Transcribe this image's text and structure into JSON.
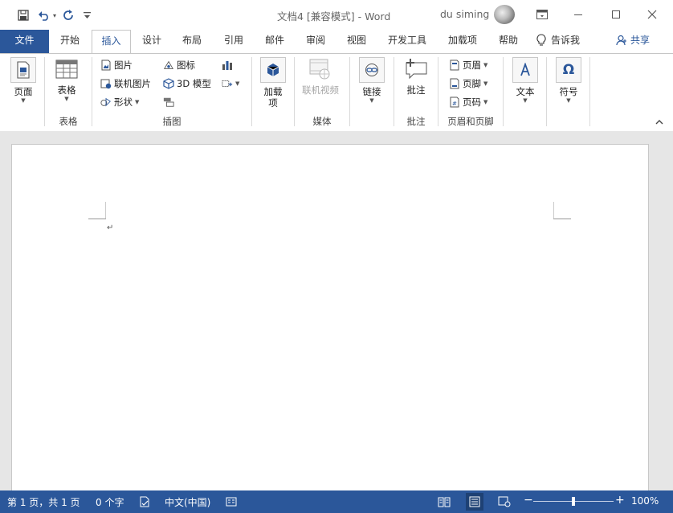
{
  "titlebar": {
    "title": "文档4 [兼容模式]  -  Word",
    "user": "du siming",
    "icons": {
      "save": "save-icon",
      "undo": "undo-icon",
      "redo": "redo-icon",
      "customize": "customize-qat-icon"
    }
  },
  "tabs": {
    "file": "文件",
    "home": "开始",
    "insert": "插入",
    "design": "设计",
    "layout": "布局",
    "references": "引用",
    "mailings": "邮件",
    "review": "审阅",
    "view": "视图",
    "developer": "开发工具",
    "addins": "加载项",
    "help": "帮助",
    "tellme": "告诉我",
    "share": "共享",
    "active": "insert"
  },
  "ribbon": {
    "pages": {
      "label": "页面"
    },
    "tables": {
      "button": "表格",
      "group": "表格"
    },
    "illustrations": {
      "group": "插图",
      "picture": "图片",
      "online_picture": "联机图片",
      "shapes": "形状",
      "icons": "图标",
      "model3d": "3D 模型"
    },
    "addins": {
      "line1": "加载",
      "line2": "项"
    },
    "media": {
      "online_video": "联机视频",
      "group": "媒体"
    },
    "links": {
      "button": "链接"
    },
    "comments": {
      "button": "批注",
      "group": "批注"
    },
    "header_footer": {
      "header": "页眉",
      "footer": "页脚",
      "page_number": "页码",
      "group": "页眉和页脚"
    },
    "text": {
      "button": "文本"
    },
    "symbols": {
      "button": "符号"
    }
  },
  "document": {
    "paragraph_mark": "↵"
  },
  "status": {
    "page": "第 1 页，共 1 页",
    "words": "0 个字",
    "language": "中文(中国)",
    "zoom": "100%",
    "zoom_fraction": 0.5
  },
  "colors": {
    "accent": "#2b579a",
    "workspace": "#e6e6e6"
  }
}
